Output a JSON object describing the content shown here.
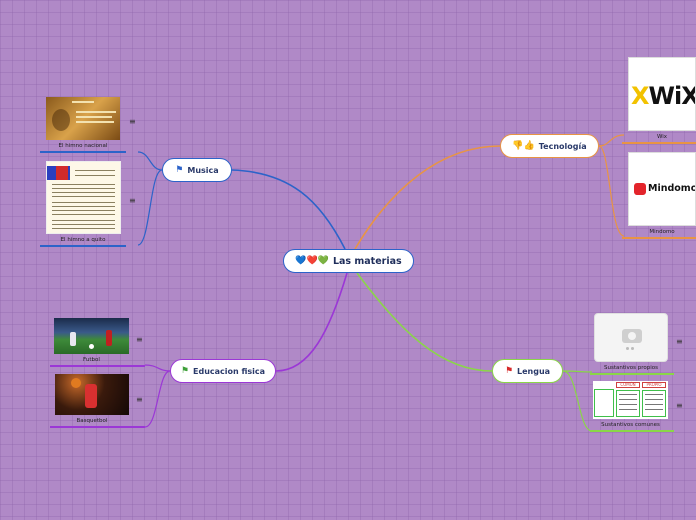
{
  "map": {
    "central": {
      "emoji": "💙❤️💚",
      "label": "Las materias"
    },
    "branches": {
      "musica": {
        "label": "Musica",
        "flag": "⚑",
        "color": "#2c63c9",
        "leaves": [
          {
            "caption": "El himno nacional",
            "image": "document-scan-gold"
          },
          {
            "caption": "El himno a quito",
            "image": "lyrics-page-flag"
          }
        ]
      },
      "tecnologia": {
        "label": "Tecnología",
        "emoji": "👎👍",
        "color": "#e89444",
        "leaves": [
          {
            "caption": "Wix",
            "logo_text": "WiX"
          },
          {
            "caption": "Mindomo",
            "logo_text": "Mindomo"
          }
        ]
      },
      "educacion": {
        "label": "Educacion fisica",
        "flag": "⚑",
        "color": "#9b37d6",
        "leaves": [
          {
            "caption": "Futbol",
            "image": "soccer-photo"
          },
          {
            "caption": "Basquetbol",
            "image": "basketball-photo"
          }
        ]
      },
      "lengua": {
        "label": "Lengua",
        "flag": "⚑",
        "color": "#8ad648",
        "leaves": [
          {
            "caption": "Sustantivos propios",
            "image": "camera-placeholder"
          },
          {
            "caption": "Sustantivos comunes",
            "image": "comparison-table",
            "table_headers": [
              "COMÚN",
              "PROPIO"
            ]
          }
        ]
      }
    },
    "menu_glyph": "≡"
  }
}
